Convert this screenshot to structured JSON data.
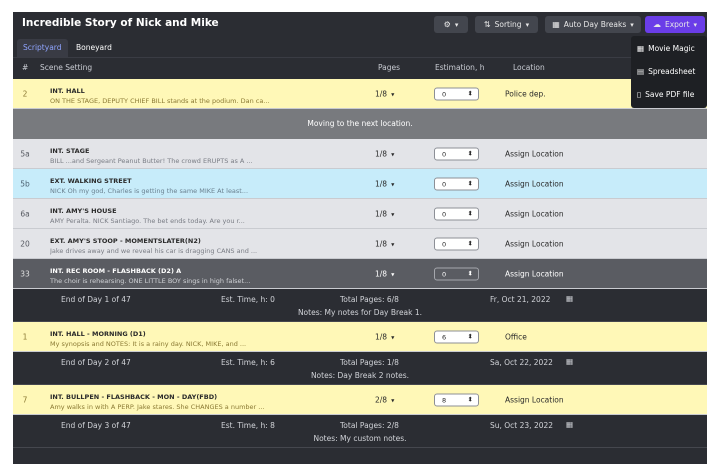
{
  "app": {
    "title": "Incredible Story of Nick and Mike"
  },
  "toolbar": {
    "settings_icon": "gear-icon",
    "sorting_label": "Sorting",
    "auto_day_breaks_label": "Auto Day Breaks",
    "export_label": "Export"
  },
  "export_menu": {
    "items": [
      {
        "label": "Movie Magic",
        "icon": "calendar-icon"
      },
      {
        "label": "Spreadsheet",
        "icon": "grid-icon"
      },
      {
        "label": "Save PDF file",
        "icon": "document-icon"
      }
    ]
  },
  "tabs": [
    "Scriptyard",
    "Boneyard"
  ],
  "columns": {
    "num": "#",
    "scene_setting": "Scene Setting",
    "pages": "Pages",
    "estimation": "Estimation, h",
    "location": "Location"
  },
  "rows": [
    {
      "kind": "scene",
      "color": "yellow",
      "num": "2",
      "heading": "INT. HALL",
      "synopsis": "ON THE STAGE, DEPUTY CHIEF BILL stands at the podium. Dan ca...",
      "pages": "1/8",
      "est": "0",
      "location": "Police dep."
    },
    {
      "kind": "banner",
      "text": "Moving to the next location."
    },
    {
      "kind": "scene",
      "color": "gray",
      "num": "5a",
      "heading": "INT. STAGE",
      "synopsis": "BILL ...and Sergeant Peanut Butter! The crowd ERUPTS as A ...",
      "pages": "1/8",
      "est": "0",
      "location": "Assign Location"
    },
    {
      "kind": "scene",
      "color": "blue",
      "num": "5b",
      "heading": "EXT. WALKING STREET",
      "synopsis": "NICK Oh my god, Charles is getting the same MIKE At least...",
      "pages": "1/8",
      "est": "0",
      "location": "Assign Location"
    },
    {
      "kind": "scene",
      "color": "gray",
      "num": "6a",
      "heading": "INT. AMY'S HOUSE",
      "synopsis": "AMY Peralta. NICK Santiago. The bet ends today. Are you r...",
      "pages": "1/8",
      "est": "0",
      "location": "Assign Location"
    },
    {
      "kind": "scene",
      "color": "gray",
      "num": "20",
      "heading": "EXT. AMY'S STOOP - MOMENTSLATER(N2)",
      "synopsis": "Jake drives away and we reveal his car is dragging CANS and ...",
      "pages": "1/8",
      "est": "0",
      "location": "Assign Location"
    },
    {
      "kind": "scene",
      "color": "dark",
      "num": "33",
      "heading": "INT. REC ROOM - FLASHBACK (D2) A",
      "synopsis": "The choir is rehearsing. ONE LITTLE BOY sings in high falset...",
      "pages": "1/8",
      "est": "0",
      "location": "Assign Location"
    },
    {
      "kind": "daybreak",
      "end": "End of Day 1 of 47",
      "est": "Est. Time, h: 0",
      "total": "Total Pages: 6/8",
      "date": "Fr, Oct 21, 2022",
      "notes": "Notes: My notes for Day Break 1."
    },
    {
      "kind": "scene",
      "color": "yellow",
      "num": "1",
      "heading": "INT. HALL - MORNING (D1)",
      "synopsis": "My synopsis and NOTES: It is a rainy day. NICK, MIKE, and ...",
      "pages": "1/8",
      "est": "6",
      "location": "Office"
    },
    {
      "kind": "daybreak",
      "end": "End of Day 2 of 47",
      "est": "Est. Time, h: 6",
      "total": "Total Pages: 1/8",
      "date": "Sa, Oct 22, 2022",
      "notes": "Notes: Day Break 2 notes."
    },
    {
      "kind": "scene",
      "color": "yellow",
      "num": "7",
      "heading": "INT. BULLPEN - FLASHBACK - MON - DAY(FBD)",
      "synopsis": "Amy walks in with A PERP. Jake stares. She CHANGES a number ...",
      "pages": "2/8",
      "est": "8",
      "location": "Assign Location"
    },
    {
      "kind": "daybreak",
      "end": "End of Day 3 of 47",
      "est": "Est. Time, h: 8",
      "total": "Total Pages: 2/8",
      "date": "Su, Oct 23, 2022",
      "notes": "Notes: My custom notes."
    }
  ]
}
